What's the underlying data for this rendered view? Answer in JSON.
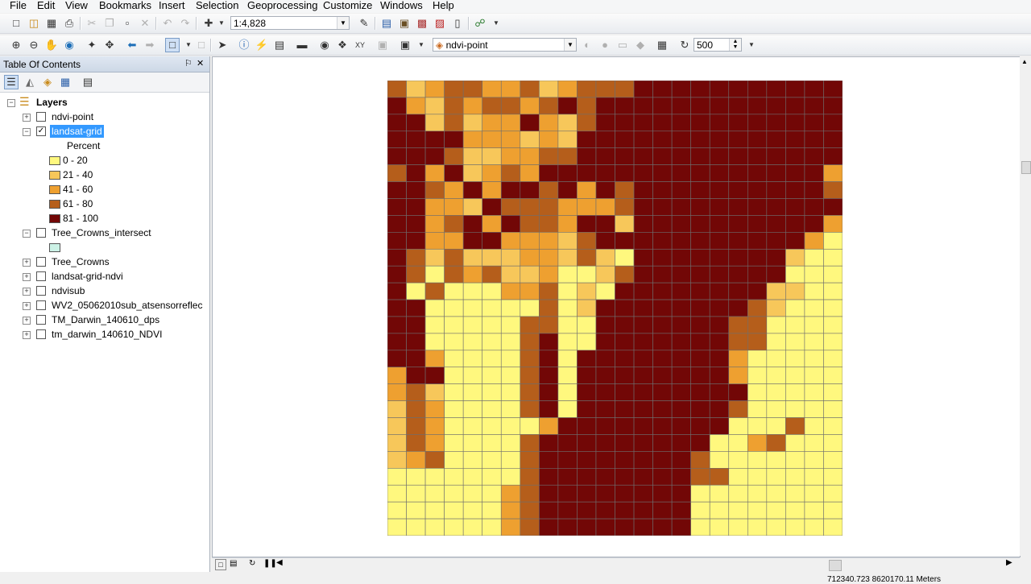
{
  "menu": [
    "File",
    "Edit",
    "View",
    "Bookmarks",
    "Insert",
    "Selection",
    "Geoprocessing",
    "Customize",
    "Windows",
    "Help"
  ],
  "toolbar": {
    "scale": "1:4,828",
    "layer_combo": "ndvi-point",
    "number_field": "500"
  },
  "toc": {
    "title": "Table Of Contents",
    "pin": "⚐",
    "close": "✕",
    "root": "Layers",
    "layers": {
      "ndvi_point": "ndvi-point",
      "landsat_grid": "landsat-grid",
      "landsat_field": "Percent",
      "tree_crowns_intersect": "Tree_Crowns_intersect",
      "tree_crowns": "Tree_Crowns",
      "landsat_grid_ndvi": "landsat-grid-ndvi",
      "ndvisub": "ndvisub",
      "wv2": "WV2_05062010sub_atsensorreflec",
      "tm_dps": "TM_Darwin_140610_dps",
      "tm_ndvi": "tm_darwin_140610_NDVI"
    },
    "legend": [
      {
        "label": "0 - 20",
        "color": "#fff87e"
      },
      {
        "label": "21 - 40",
        "color": "#f7c75a"
      },
      {
        "label": "41 - 60",
        "color": "#eea030"
      },
      {
        "label": "61 - 80",
        "color": "#b55e1b"
      },
      {
        "label": "81 - 100",
        "color": "#720706"
      }
    ],
    "intersect_color": "#ccf2e6"
  },
  "status": {
    "coords": "712340.723 8620170.11 Meters"
  },
  "grid_data": {
    "cols": 24,
    "colors": [
      "#fff87e",
      "#f7c75a",
      "#eea030",
      "#b55e1b",
      "#720706"
    ],
    "rows": [
      "312332231233344444444444",
      "421323323434444444444444",
      "441312242134444444444444",
      "444422212144444444444444",
      "444311223344444444444444",
      "342412324444444444444442",
      "443242443424344444444443",
      "442214333222344444444444",
      "442342433244144444444442",
      "442244222134444444444420",
      "431311122131044444444100",
      "430323112001344444444000",
      "403000223010444444441100",
      "440000003014444444431000",
      "440000033004444444330000",
      "440000034004444444330000",
      "442000034044444444200000",
      "244000034044444444200000",
      "231000034044444444400000",
      "132000034044444444300000",
      "132000002444444444000300",
      "132000034444444440023000",
      "123000034444444430000000",
      "000000034444444433000000",
      "000000234444444400000000",
      "000000234444444400000000",
      "000000234444444400000000"
    ]
  }
}
